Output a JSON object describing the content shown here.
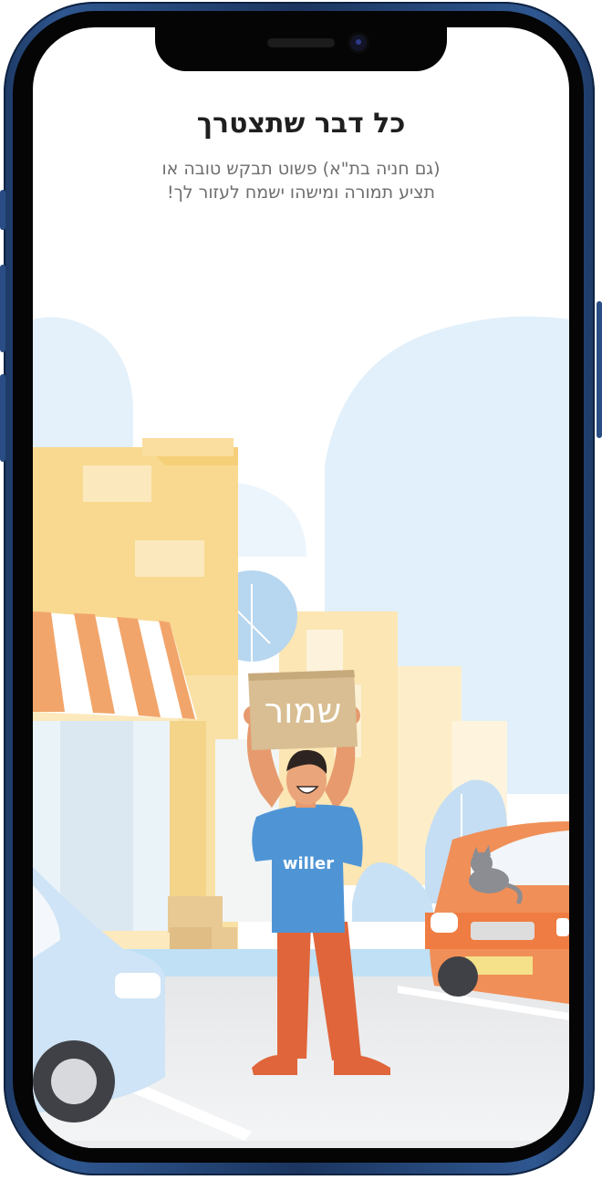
{
  "screen": {
    "title": "כל דבר שתצטרך",
    "subtitle_line1": "(גם חניה בת\"א) פשוט תבקש טובה או",
    "subtitle_line2": "תציע תמורה ומישהו ישמח לעזור לך!"
  },
  "illustration": {
    "sign_text": "שמור",
    "shirt_text": "willer"
  },
  "colors": {
    "title": "#1f1f1f",
    "subtitle": "#6e6e6e",
    "shirt": "#4f95d6",
    "pants": "#e0653a",
    "building": "#f8d98f",
    "frame": "#2a4d85"
  },
  "icons": {
    "camera": "front-camera",
    "speaker": "earpiece-speaker"
  }
}
